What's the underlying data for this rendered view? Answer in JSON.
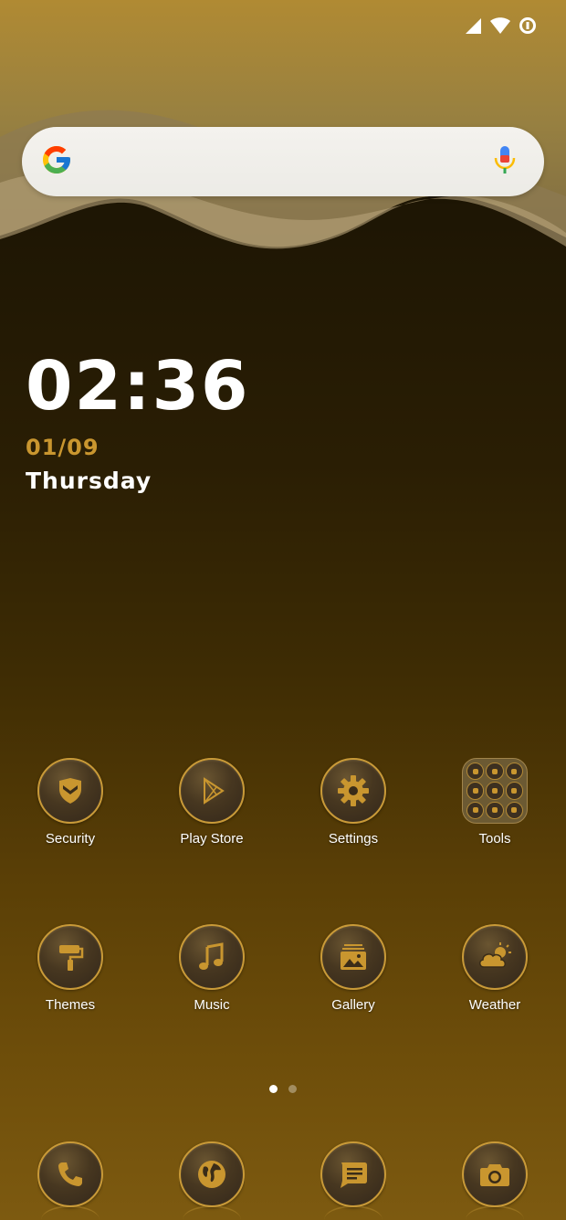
{
  "status_bar": {
    "icons": [
      "cellular-signal-icon",
      "wifi-icon",
      "data-saver-icon"
    ]
  },
  "search": {
    "logo": "google-logo-icon",
    "mic": "microphone-icon"
  },
  "clock": {
    "time": "02:36",
    "date": "01/09",
    "weekday": "Thursday"
  },
  "apps_row1": [
    {
      "label": "Security",
      "icon": "shield-icon"
    },
    {
      "label": "Play Store",
      "icon": "play-triangle-icon"
    },
    {
      "label": "Settings",
      "icon": "gear-icon"
    },
    {
      "label": "Tools",
      "icon": "folder-icon"
    }
  ],
  "apps_row2": [
    {
      "label": "Themes",
      "icon": "paint-roller-icon"
    },
    {
      "label": "Music",
      "icon": "music-note-icon"
    },
    {
      "label": "Gallery",
      "icon": "gallery-icon"
    },
    {
      "label": "Weather",
      "icon": "weather-icon"
    }
  ],
  "dock": [
    {
      "icon": "phone-icon"
    },
    {
      "icon": "globe-icon"
    },
    {
      "icon": "message-icon"
    },
    {
      "icon": "camera-icon"
    }
  ],
  "page_indicator": {
    "count": 2,
    "active": 1
  },
  "colors": {
    "accent_gold": "#c9962f",
    "icon_border": "#c99a38",
    "text": "#ffffff"
  }
}
